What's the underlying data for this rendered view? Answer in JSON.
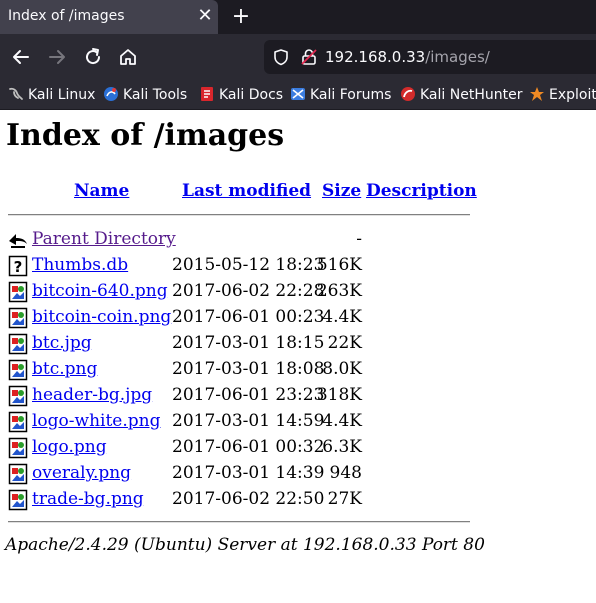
{
  "browser": {
    "tab_title": "Index of /images",
    "tab_close": "✕",
    "new_tab": "+",
    "url_host": "192.168.0.33",
    "url_path": "/images/",
    "bookmarks": [
      {
        "label": "Kali Linux",
        "icon": "kali-dragon-icon"
      },
      {
        "label": "Kali Tools",
        "icon": "kali-tools-icon"
      },
      {
        "label": "Kali Docs",
        "icon": "kali-docs-icon"
      },
      {
        "label": "Kali Forums",
        "icon": "kali-forums-icon"
      },
      {
        "label": "Kali NetHunter",
        "icon": "nethunter-icon"
      },
      {
        "label": "Exploit-",
        "icon": "exploit-db-icon"
      }
    ]
  },
  "page": {
    "title": "Index of /images",
    "columns": {
      "name": "Name",
      "modified": "Last modified",
      "size": "Size",
      "description": "Description"
    },
    "parent": {
      "name": "Parent Directory",
      "size": "-"
    },
    "files": [
      {
        "name": "Thumbs.db",
        "modified": "2015-05-12 18:23",
        "size": "516K",
        "icon": "unknown-file-icon"
      },
      {
        "name": "bitcoin-640.png",
        "modified": "2017-06-02 22:28",
        "size": "263K",
        "icon": "image-file-icon"
      },
      {
        "name": "bitcoin-coin.png",
        "modified": "2017-06-01 00:23",
        "size": "4.4K",
        "icon": "image-file-icon"
      },
      {
        "name": "btc.jpg",
        "modified": "2017-03-01 18:15",
        "size": "22K",
        "icon": "image-file-icon"
      },
      {
        "name": "btc.png",
        "modified": "2017-03-01 18:08",
        "size": "8.0K",
        "icon": "image-file-icon"
      },
      {
        "name": "header-bg.jpg",
        "modified": "2017-06-01 23:23",
        "size": "318K",
        "icon": "image-file-icon"
      },
      {
        "name": "logo-white.png",
        "modified": "2017-03-01 14:59",
        "size": "4.4K",
        "icon": "image-file-icon"
      },
      {
        "name": "logo.png",
        "modified": "2017-06-01 00:32",
        "size": "6.3K",
        "icon": "image-file-icon"
      },
      {
        "name": "overaly.png",
        "modified": "2017-03-01 14:39",
        "size": "948",
        "icon": "image-file-icon"
      },
      {
        "name": "trade-bg.png",
        "modified": "2017-06-02 22:50",
        "size": "27K",
        "icon": "image-file-icon"
      }
    ],
    "footer": "Apache/2.4.29 (Ubuntu) Server at 192.168.0.33 Port 80"
  },
  "colors": {
    "link": "#0000ee",
    "visited": "#551a8b",
    "chrome_dark": "#1c1b22",
    "chrome": "#2b2a33"
  }
}
